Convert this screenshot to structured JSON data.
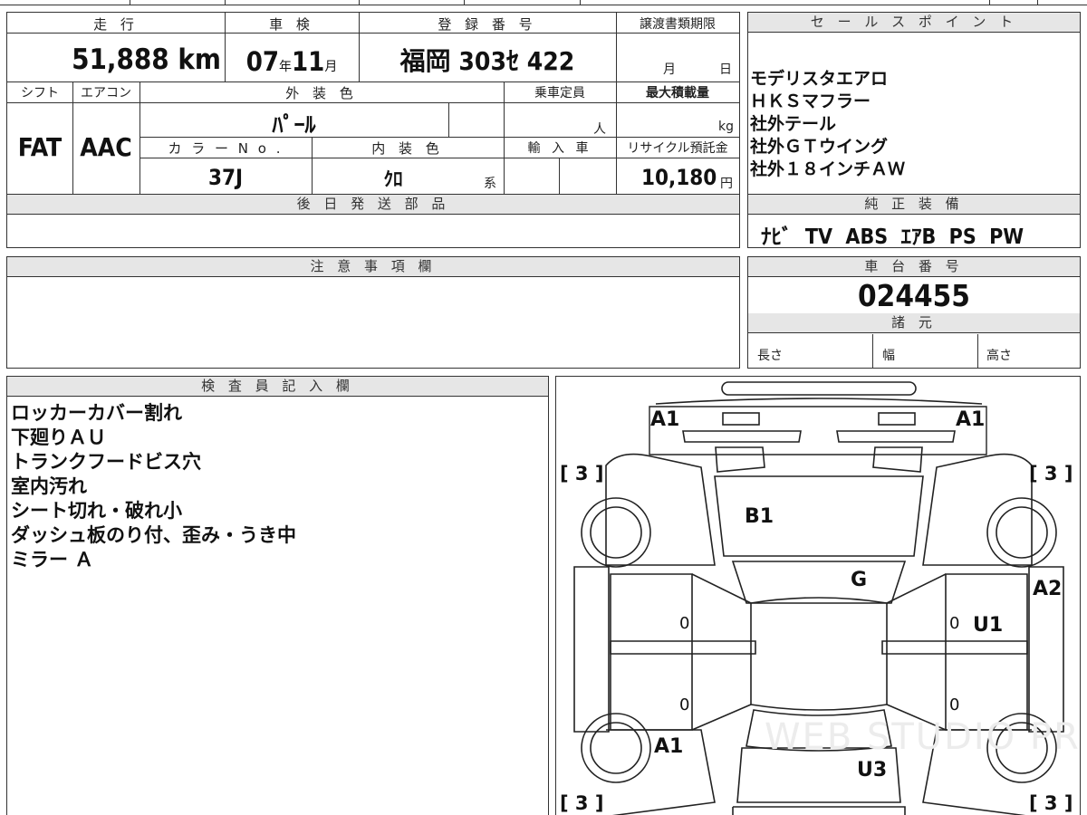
{
  "top_row": {
    "mileage_label": "走 行",
    "mileage_value": "51,888",
    "mileage_unit": "km",
    "inspection_label": "車 検",
    "inspection_year": "07",
    "inspection_year_unit": "年",
    "inspection_month": "11",
    "inspection_month_unit": "月",
    "registration_label": "登 録 番 号",
    "registration_value": "福岡 303ｾ 422",
    "deadline_label": "譲渡書類期限",
    "deadline_month_unit": "月",
    "deadline_day_unit": "日"
  },
  "second_row": {
    "shift_label": "シフト",
    "shift_value": "FAT",
    "aircon_label": "エアコン",
    "aircon_value": "AAC",
    "exterior_color_label": "外 装 色",
    "exterior_color_value": "ﾊﾟｰﾙ",
    "capacity_label": "乗車定員",
    "capacity_unit": "人",
    "max_load_label": "最大積載量",
    "max_load_unit": "kg",
    "color_no_label": "カ ラ ー N o .",
    "color_no_value": "37J",
    "interior_color_label": "内 装 色",
    "interior_color_value": "ｸﾛ",
    "interior_color_suffix": "系",
    "import_label": "輸 入 車",
    "recycle_label": "リサイクル預託金",
    "recycle_value": "10,180",
    "recycle_unit": "円"
  },
  "later_parts": {
    "label": "後 日 発 送 部 品"
  },
  "sales_points": {
    "label": "セ ー ル ス ポ イ ン ト",
    "items": [
      "モデリスタエアロ",
      "ＨＫＳマフラー",
      "社外テール",
      "社外ＧＴウイング",
      "社外１８インチＡＷ"
    ]
  },
  "standard_equipment": {
    "label": "純 正 装 備",
    "value": "ﾅﾋﾞ  TV  ABS  ｴｱB  PS  PW"
  },
  "notes": {
    "label": "注 意 事 項 欄"
  },
  "chassis": {
    "label": "車 台 番 号",
    "value": "024455"
  },
  "specs": {
    "label": "諸 元",
    "length_label": "長さ",
    "width_label": "幅",
    "height_label": "高さ"
  },
  "inspector": {
    "label": "検 査 員 記 入 欄",
    "items": [
      "ロッカーカバー割れ",
      "下廻りＡＵ",
      "トランクフードビス穴",
      "室内汚れ",
      "シート切れ・破れ小",
      "ダッシュ板のり付、歪み・うき中",
      "ミラー Ａ"
    ]
  },
  "diagram": {
    "marks": {
      "front_left": "A1",
      "front_right": "A1",
      "hood": "B1",
      "windshield": "G",
      "right_rear_door": "A2",
      "right_rocker": "U1",
      "left_rear": "A1",
      "rear": "U3",
      "tire_fl": "[ 3 ]",
      "tire_fr": "[ 3 ]",
      "tire_rl": "[ 3 ]",
      "tire_rr": "[ 3 ]",
      "zero_1": "0",
      "zero_2": "0",
      "zero_3": "0",
      "zero_4": "0"
    }
  },
  "watermark": "WEB STUDIO PRO"
}
